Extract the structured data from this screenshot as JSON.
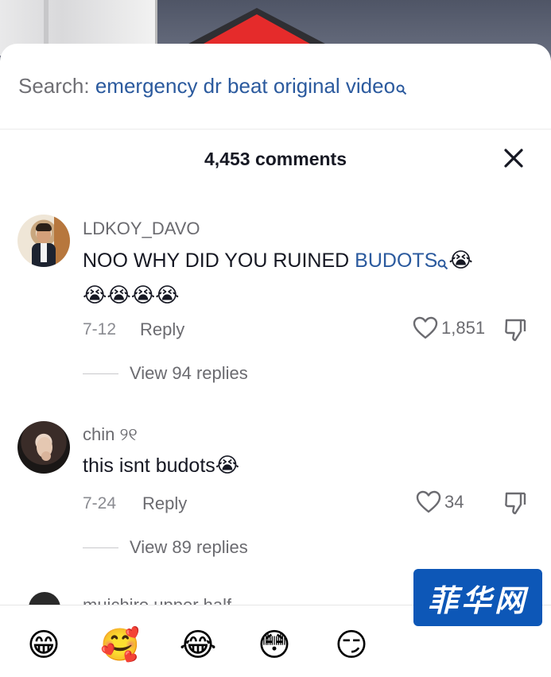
{
  "search": {
    "prefix": "Search:",
    "query": "emergency dr beat original video"
  },
  "header": {
    "comment_count": "4,453 comments"
  },
  "comments": [
    {
      "username": "LDKOY_DAVO",
      "text_before": "NOO WHY DID YOU RUINED ",
      "text_link": "BUDOTS",
      "emoji_line1": "😭",
      "emoji_line2": "😭😭😭😭",
      "date": "7-12",
      "reply_label": "Reply",
      "likes": "1,851",
      "view_replies": "View 94 replies"
    },
    {
      "username": "chin ୨୧",
      "text_before": "this isnt budots",
      "emoji_line1": "😭",
      "date": "7-24",
      "reply_label": "Reply",
      "likes": "34",
      "view_replies": "View 89 replies"
    },
    {
      "username": "muichiro upper half"
    }
  ],
  "emoji_bar": [
    "😁",
    "🥰",
    "😂",
    "😳",
    "😏"
  ],
  "watermark": "菲华网",
  "colors": {
    "link": "#2b5a9e",
    "text": "#161823",
    "muted": "#6b6b70",
    "watermark_bg": "#0d57b7"
  },
  "icons": {
    "search_hint": "search-icon",
    "close": "close-icon",
    "like": "heart-icon",
    "dislike": "thumbs-down-icon"
  }
}
